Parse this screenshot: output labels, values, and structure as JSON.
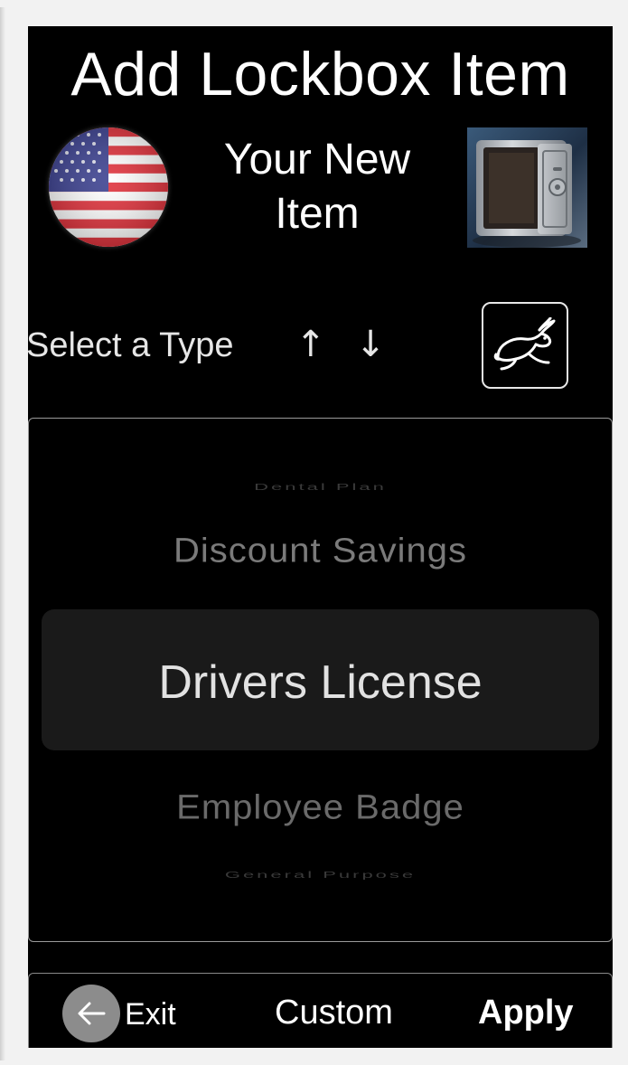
{
  "header": {
    "title": "Add Lockbox Item",
    "subtitle_line1": "Your New",
    "subtitle_line2": "Item",
    "flag_icon": "us-flag-icon",
    "safe_icon": "safe-image-icon"
  },
  "type_selector": {
    "label": "Select a Type",
    "sort_arrows": "↑ ↓",
    "quick_button_icon": "rabbit-icon"
  },
  "picker": {
    "items": [
      "Dental Plan",
      "Discount Savings",
      "Drivers License",
      "Employee Badge",
      "General Purpose"
    ],
    "selected": "Drivers License"
  },
  "footer": {
    "exit_label": "Exit",
    "custom_label": "Custom",
    "apply_label": "Apply"
  },
  "colors": {
    "background": "#000000",
    "text": "#ffffff",
    "picker_highlight": "#1a1a1a",
    "back_button": "#8c8c8c"
  }
}
